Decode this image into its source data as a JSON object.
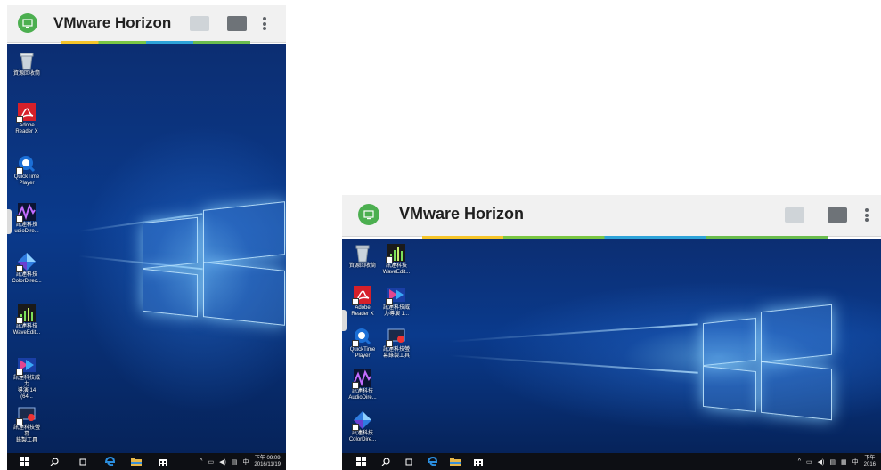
{
  "app": {
    "title": "VMware Horizon"
  },
  "colors": {
    "accent_green": "#4caf50",
    "desktop_blue": "#0a3a8c",
    "taskbar": "#0d0f14"
  },
  "portrait": {
    "icons": [
      {
        "label": "資源回收筒",
        "icon": "recycle-bin-icon"
      },
      {
        "label": "Adobe\nReader X",
        "icon": "pdf-icon"
      },
      {
        "label": "QuickTime\nPlayer",
        "icon": "quicktime-icon"
      },
      {
        "label": "訊連科技\nudioDire...",
        "icon": "audiodirector-icon"
      },
      {
        "label": "訊連科技\nColorDirec...",
        "icon": "colordirector-icon"
      },
      {
        "label": "訊連科技\nWaveEdit...",
        "icon": "waveeditor-icon"
      },
      {
        "label": "訊連科技威力\n導演 14 (64...",
        "icon": "powerdirector-icon"
      },
      {
        "label": "訊連科技螢幕\n錄製工具",
        "icon": "screen-recorder-icon"
      }
    ],
    "clock": {
      "time": "下午 09:09",
      "date": "2016/11/19"
    },
    "ime": "中"
  },
  "landscape": {
    "icons": [
      {
        "label": "資源回收筒",
        "icon": "recycle-bin-icon"
      },
      {
        "label": "訊連科技\nWaveEdit...",
        "icon": "waveeditor-icon"
      },
      {
        "label": "Adobe\nReader X",
        "icon": "pdf-icon"
      },
      {
        "label": "訊連科技威\n力導演 1...",
        "icon": "powerdirector-icon"
      },
      {
        "label": "QuickTime\nPlayer",
        "icon": "quicktime-icon"
      },
      {
        "label": "訊連科技螢\n幕錄製工具",
        "icon": "screen-recorder-icon"
      },
      {
        "label": "訊連科技\nAudioDire...",
        "icon": "audiodirector-icon"
      },
      {
        "label": "訊連科技\nColorDire...",
        "icon": "colordirector-icon"
      }
    ],
    "clock": {
      "time": "下午",
      "date": "2016"
    },
    "ime": "中"
  }
}
